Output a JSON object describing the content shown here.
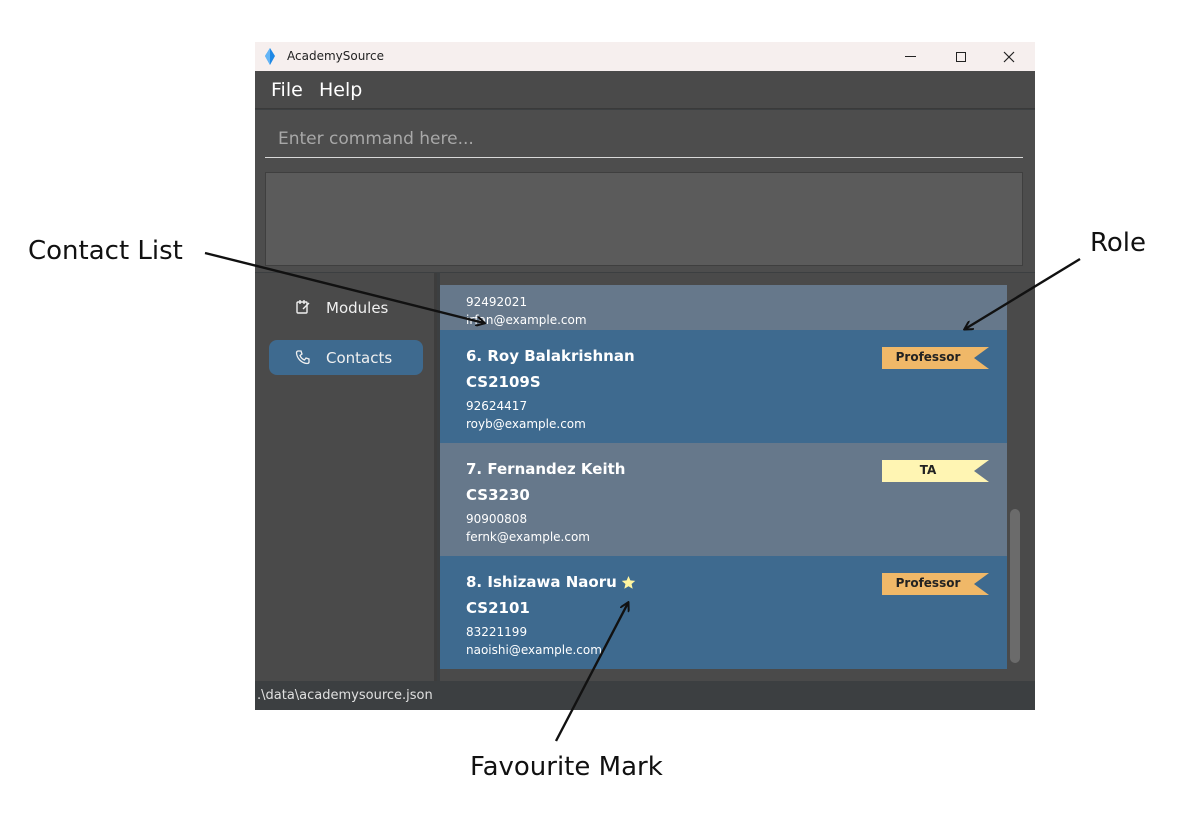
{
  "annotations": {
    "contact_list": "Contact List",
    "role": "Role",
    "favourite_mark": "Favourite Mark"
  },
  "window": {
    "title": "AcademySource",
    "controls": {
      "minimize": "—",
      "maximize": "□",
      "close": "✕"
    }
  },
  "menu": {
    "file": "File",
    "help": "Help"
  },
  "command": {
    "placeholder": "Enter command here..."
  },
  "sidebar": {
    "items": [
      {
        "label": "Modules",
        "icon": "notebook-icon",
        "active": false
      },
      {
        "label": "Contacts",
        "icon": "phone-icon",
        "active": true
      }
    ]
  },
  "contacts": {
    "partial": {
      "phone": "92492021",
      "email": "irfan@example.com"
    },
    "cards": [
      {
        "name": "6. Roy Balakrishnan",
        "module": "CS2109S",
        "phone": "92624417",
        "email": "royb@example.com",
        "role": "Professor",
        "favourite": false
      },
      {
        "name": "7. Fernandez Keith",
        "module": "CS3230",
        "phone": "90900808",
        "email": "fernk@example.com",
        "role": "TA",
        "favourite": false
      },
      {
        "name": "8. Ishizawa Naoru",
        "module": "CS2101",
        "phone": "83221199",
        "email": "naoishi@example.com",
        "role": "Professor",
        "favourite": true
      }
    ]
  },
  "colors": {
    "professor_tag": "#f0b868",
    "ta_tag": "#fff5b3",
    "card_dark": "#3e6a8f",
    "card_light": "#66788b",
    "star": "#fff5a0"
  },
  "status": {
    "path": ".\\data\\academysource.json"
  }
}
